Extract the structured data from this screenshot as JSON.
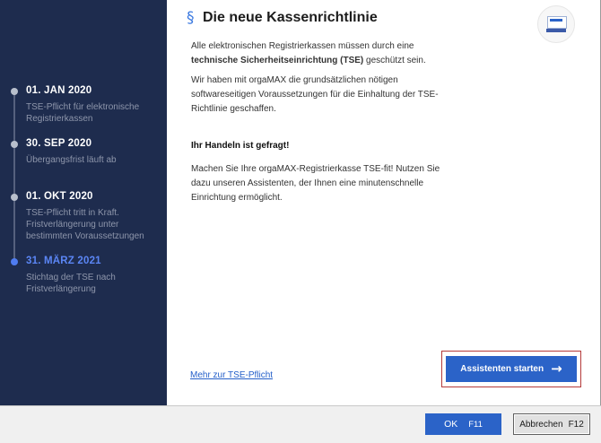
{
  "timeline": [
    {
      "date": "01. JAN 2020",
      "desc": "TSE-Pflicht für elektronische Registrierkassen",
      "active": false
    },
    {
      "date": "30. SEP 2020",
      "desc": "Übergangsfrist läuft ab",
      "active": false
    },
    {
      "date": "01. OKT 2020",
      "desc": "TSE-Pflicht tritt in Kraft. Fristverlängerung unter bestimmten Voraussetzungen",
      "active": false
    },
    {
      "date": "31. MÄRZ 2021",
      "desc": "Stichtag der TSE nach Fristverlängerung",
      "active": true
    }
  ],
  "content": {
    "section_icon": "§",
    "title": "Die neue Kassenrichtlinie",
    "intro_pre": "Alle elektronischen Registrierkassen müssen durch eine ",
    "intro_bold": "technische Sicherheitseinrichtung (TSE)",
    "intro_post": " geschützt sein.",
    "para2": "Wir haben mit orgaMAX die grundsätzlichen nötigen softwareseitigen Voraussetzungen für die Einhaltung der TSE-Richtlinie geschaffen.",
    "heading2": "Ihr Handeln ist gefragt!",
    "para3": "Machen Sie Ihre orgaMAX-Registrierkasse TSE-fit! Nutzen Sie dazu unseren Assistenten, der Ihnen eine minutenschnelle Einrichtung ermöglicht.",
    "more_link": "Mehr zur TSE-Pflicht",
    "assistant_button": "Assistenten starten",
    "arrow_icon": "→",
    "logo_icon": "tse-register-icon"
  },
  "footer": {
    "ok_label": "OK",
    "ok_key": "F11",
    "cancel_label": "Abbrechen",
    "cancel_key": "F12"
  },
  "colors": {
    "sidebar_bg": "#1e2c4e",
    "accent": "#2b63c8",
    "active_date": "#5b86f5"
  }
}
